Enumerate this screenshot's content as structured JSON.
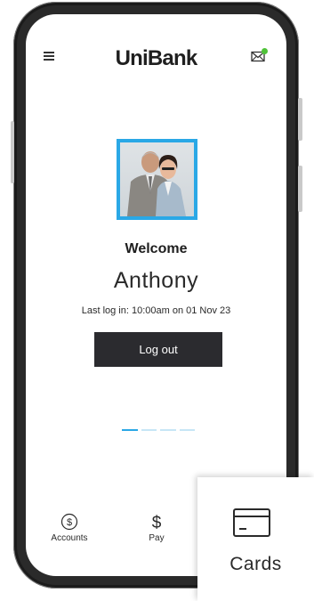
{
  "header": {
    "brand": "UniBank",
    "menu_icon": "hamburger-menu-icon",
    "mail_icon": "envelope-icon",
    "notification_color": "#4fc238"
  },
  "profile": {
    "photo": "profile-photo",
    "frame_color": "#2aa8e6"
  },
  "main": {
    "welcome": "Welcome",
    "user_name": "Anthony",
    "last_login": "Last log in: 10:00am on 01 Nov 23",
    "logout_label": "Log out"
  },
  "pager": {
    "pages": 4,
    "active_index": 0
  },
  "bottom_nav": {
    "items": [
      {
        "label": "Accounts",
        "icon": "dollar-circle-icon"
      },
      {
        "label": "Pay",
        "icon": "dollar-sign-icon"
      }
    ]
  },
  "cards_popup": {
    "label": "Cards",
    "icon": "credit-card-icon"
  }
}
